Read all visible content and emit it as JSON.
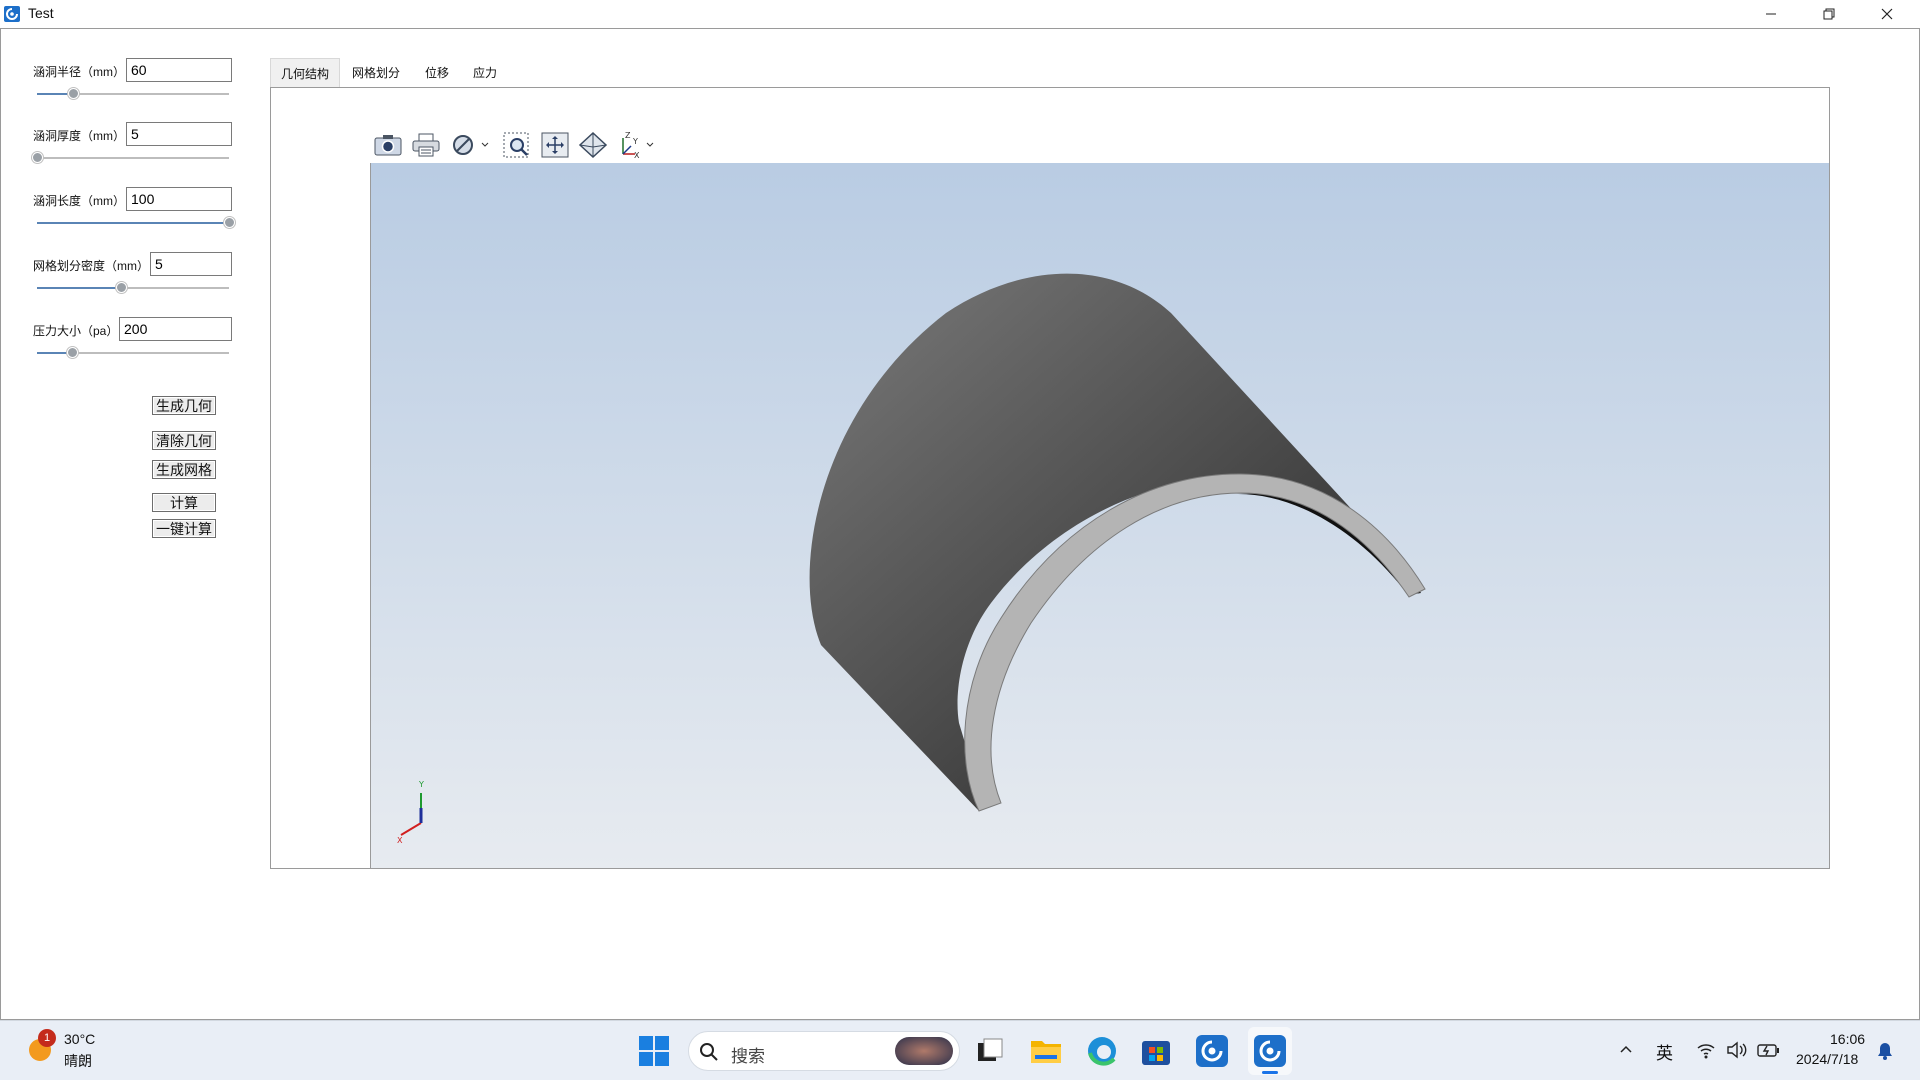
{
  "window": {
    "title": "Test"
  },
  "params": [
    {
      "label": "涵洞半径（mm）",
      "value": "60",
      "slider": 0.19
    },
    {
      "label": "涵洞厚度（mm）",
      "value": "5",
      "slider": 0.0
    },
    {
      "label": "涵洞长度（mm）",
      "value": "100",
      "slider": 1.0
    },
    {
      "label": "网格划分密度（mm）",
      "value": "5",
      "slider": 0.44
    },
    {
      "label": "压力大小（pa）",
      "value": "200",
      "slider": 0.18
    }
  ],
  "actions": {
    "gen_geometry": "生成几何",
    "clear_geometry": "清除几何",
    "gen_mesh": "生成网格",
    "compute": "计算",
    "one_click": "一键计算"
  },
  "tabs": [
    "几何结构",
    "网格划分",
    "位移",
    "应力"
  ],
  "active_tab": 0,
  "toolbar": [
    "camera-icon",
    "print-icon",
    "display-mode-icon",
    "zoom-box-icon",
    "fit-all-icon",
    "view-iso-icon",
    "axes-icon"
  ],
  "viewport": {
    "axis_labels": {
      "x": "X",
      "y": "Y",
      "z": "Z"
    },
    "background_top": "#b9cce3",
    "background_bottom": "#e7ebf0"
  },
  "taskbar": {
    "weather": {
      "temp": "30°C",
      "condition": "晴朗",
      "badge": "1"
    },
    "search_placeholder": "搜索",
    "ime": "英",
    "time": "16:06",
    "date": "2024/7/18"
  }
}
